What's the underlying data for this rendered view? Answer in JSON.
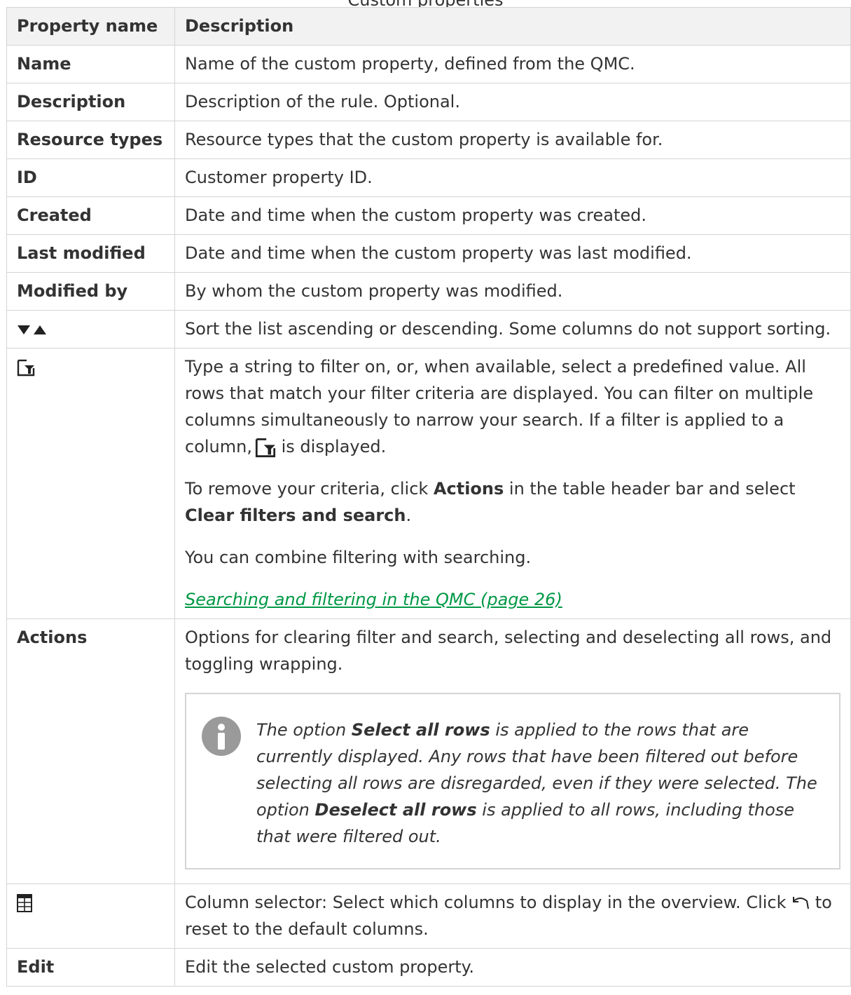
{
  "caption": "Custom properties",
  "table": {
    "headers": [
      "Property name",
      "Description"
    ],
    "rows": {
      "name": {
        "label": "Name",
        "desc": "Name of the custom property, defined from the QMC."
      },
      "description": {
        "label": "Description",
        "desc": "Description of the rule. Optional."
      },
      "resource_types": {
        "label": "Resource types",
        "desc": "Resource types that the custom property is available for."
      },
      "id": {
        "label": "ID",
        "desc": "Customer property ID."
      },
      "created": {
        "label": "Created",
        "desc": "Date and time when the custom property was created."
      },
      "last_modified": {
        "label": "Last modified",
        "desc": "Date and time when the custom property was last modified."
      },
      "modified_by": {
        "label": "Modified by",
        "desc": "By whom the custom property was modified."
      },
      "sort": {
        "icon": "sort-desc-asc-icon",
        "desc": "Sort the list ascending or descending. Some columns do not support sorting."
      },
      "filter": {
        "icon": "filter-icon",
        "p1_before": "Type a string to filter on, or, when available, select a predefined value. All rows that match your filter criteria are displayed. You can filter on multiple columns simultaneously to narrow your search. If a filter is applied to a column,",
        "p1_after": " is displayed.",
        "p2_before": "To remove your criteria, click ",
        "p2_actions": "Actions",
        "p2_middle": " in the table header bar and select ",
        "p2_clear": "Clear filters and search",
        "p2_end": ".",
        "p3": "You can combine filtering with searching.",
        "link": " Searching and filtering in the QMC (page 26)"
      },
      "actions": {
        "label": "Actions",
        "desc": "Options for clearing filter and search, selecting and deselecting all rows, and toggling wrapping.",
        "note": {
          "t1": "The option ",
          "b1": "Select all rows",
          "t2": " is applied to the rows that are currently displayed. Any rows that have been filtered out before selecting all rows are disregarded, even if they were selected. The option ",
          "b2": "Deselect all rows",
          "t3": " is applied to all rows, including those that were filtered out."
        }
      },
      "column_selector": {
        "icon": "table-columns-icon",
        "desc_before": "Column selector: Select which columns to display in the overview. Click ",
        "desc_after": " to reset to the default columns."
      },
      "edit": {
        "label": "Edit",
        "desc": "Edit the selected custom property."
      }
    }
  },
  "colors": {
    "link": "#009845",
    "border": "#d4d4d4",
    "header_bg": "#f2f2f2",
    "icon_grey": "#9a9a9a"
  }
}
